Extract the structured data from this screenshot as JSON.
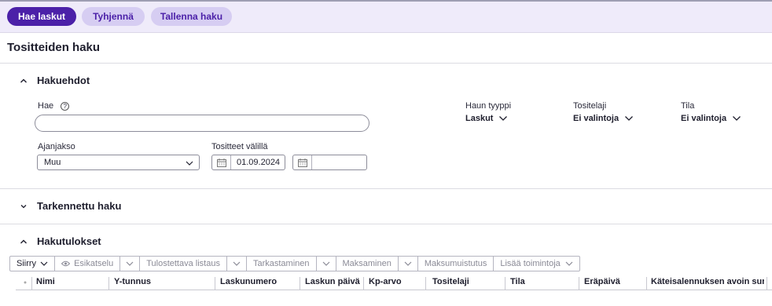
{
  "toolbar": {
    "fetch_label": "Hae laskut",
    "clear_label": "Tyhjennä",
    "save_label": "Tallenna haku"
  },
  "page_title": "Tositteiden haku",
  "criteria": {
    "title": "Hakuehdot",
    "search_label": "Hae",
    "search_help_glyph": "?",
    "search_value": "",
    "period_label": "Ajanjakso",
    "period_value": "Muu",
    "range_label": "Tositteet välillä",
    "date_from": "01.09.2024",
    "date_to": "",
    "search_type_label": "Haun tyyppi",
    "search_type_value": "Laskut",
    "doc_type_label": "Tositelaji",
    "doc_type_value": "Ei valintoja",
    "status_label": "Tila",
    "status_value": "Ei valintoja"
  },
  "advanced": {
    "title": "Tarkennettu haku"
  },
  "results": {
    "title": "Hakutulokset",
    "actions": {
      "move": "Siirry",
      "preview": "Esikatselu",
      "print_list": "Tulostettava listaus",
      "review": "Tarkastaminen",
      "payment": "Maksaminen",
      "payment_reminder": "Maksumuistutus",
      "more": "Lisää toimintoja"
    },
    "columns": [
      "Nimi",
      "Y-tunnus",
      "Laskunumero",
      "Laskun päivä",
      "Kp-arvo",
      "Tositelaji",
      "Tila",
      "Eräpäivä",
      "Käteisalennuksen avoin summa"
    ]
  },
  "colors": {
    "accent": "#4b20a8",
    "accent_light": "#d6cdf2",
    "toolbar_bg": "#efebfa"
  }
}
